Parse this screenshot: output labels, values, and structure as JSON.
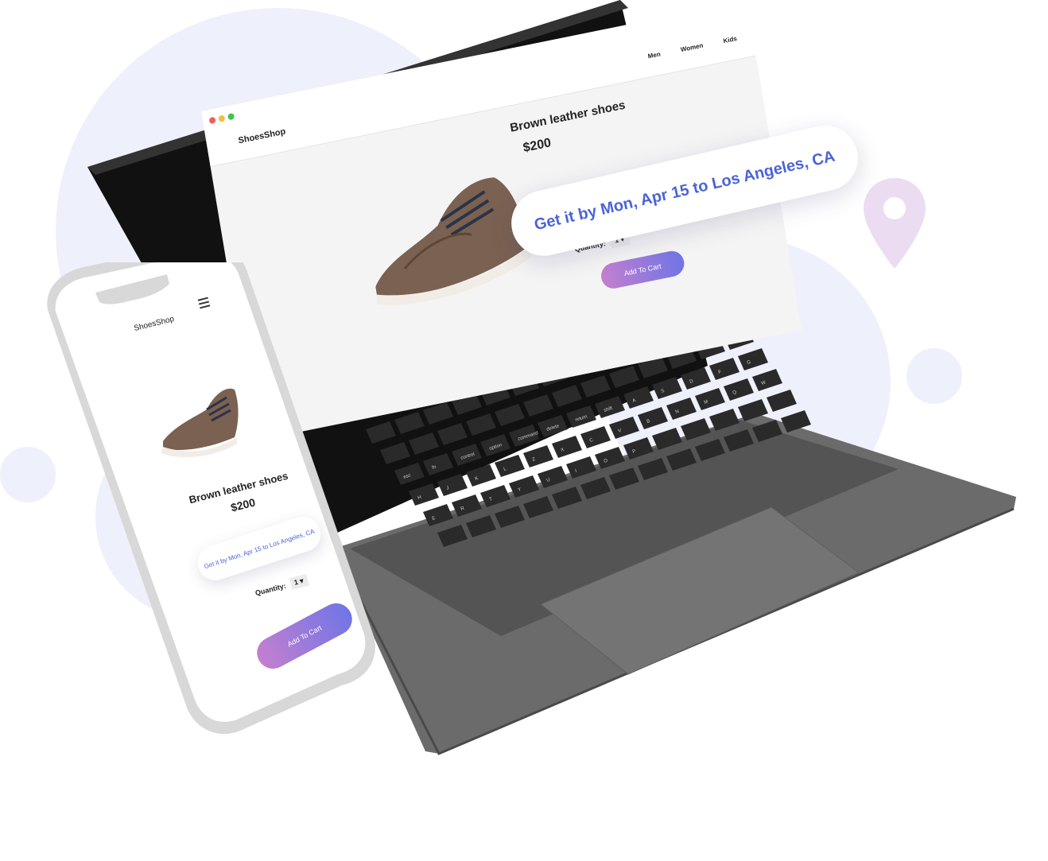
{
  "colors": {
    "accent_blue": "#4b63d8",
    "gradient_start": "#c47fcf",
    "gradient_end": "#6f75e6",
    "bg_circle": "#eef0fb",
    "pin": "#ecdcf1",
    "laptop_body": "#6d6d6d",
    "key": "#2a2a2a"
  },
  "desktop": {
    "window_dots": [
      "#f45b58",
      "#f6bc3d",
      "#3fc549"
    ],
    "brand": "ShoesShop",
    "nav": [
      "Men",
      "Women",
      "Kids"
    ],
    "product": {
      "title": "Brown leather shoes",
      "price": "$200",
      "image_icon": "brown-shoe"
    },
    "delivery": "Get it by Mon, Apr 15 to Los Angeles, CA",
    "quantity": {
      "label": "Quantity:",
      "value": "1"
    },
    "add_to_cart": "Add To Cart"
  },
  "mobile": {
    "brand": "ShoesShop",
    "menu_icon": "hamburger-icon",
    "product": {
      "title": "Brown leather shoes",
      "price": "$200",
      "image_icon": "brown-shoe"
    },
    "delivery": "Get it by Mon, Apr 15 to Los Angeles, CA",
    "quantity": {
      "label": "Quantity:",
      "value": "1"
    },
    "add_to_cart": "Add To Cart"
  },
  "decor": {
    "location_pin_icon": "map-pin-icon"
  },
  "keyboard": {
    "keys": [
      "esc",
      "fn",
      "control",
      "option",
      "command",
      "delete",
      "return",
      "shift",
      "A",
      "S",
      "D",
      "F",
      "G",
      "H",
      "J",
      "K",
      "L",
      "Z",
      "X",
      "C",
      "V",
      "B",
      "N",
      "M",
      "Q",
      "W",
      "E",
      "R",
      "T",
      "Y",
      "U",
      "I",
      "O",
      "P"
    ]
  }
}
